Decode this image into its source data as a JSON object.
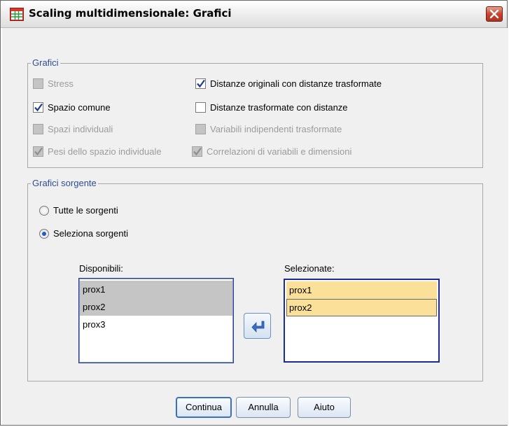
{
  "window": {
    "title": "Scaling multidimensionale: Grafici"
  },
  "grafici": {
    "legend": "Grafici",
    "options": [
      {
        "label": "Stress",
        "checked": false,
        "enabled": false
      },
      {
        "label": "Distanze originali con distanze trasformate",
        "checked": true,
        "enabled": true
      },
      {
        "label": "Spazio comune",
        "checked": true,
        "enabled": true
      },
      {
        "label": "Distanze trasformate con distanze",
        "checked": false,
        "enabled": true
      },
      {
        "label": "Spazi individuali",
        "checked": false,
        "enabled": false
      },
      {
        "label": "Variabili indipendenti trasformate",
        "checked": false,
        "enabled": false
      },
      {
        "label": "Pesi dello spazio individuale",
        "checked": true,
        "enabled": false
      },
      {
        "label": "Correlazioni di variabili e dimensioni",
        "checked": true,
        "enabled": false
      }
    ]
  },
  "sorgente": {
    "legend": "Grafici sorgente",
    "radio_all": "Tutte le sorgenti",
    "radio_select": "Seleziona sorgenti",
    "selected_radio": "select",
    "available_label": "Disponibili:",
    "available_items": [
      "prox1",
      "prox2",
      "prox3"
    ],
    "selected_label": "Selezionate:",
    "selected_items": [
      "prox1",
      "prox2"
    ]
  },
  "buttons": {
    "continue": "Continua",
    "cancel": "Annulla",
    "help": "Aiuto"
  },
  "colors": {
    "legend_text": "#2f4d92",
    "list_selection_gray": "#c5c5c5",
    "list_selection_yellow": "#fbe09a",
    "close_button": "#c9452f"
  },
  "icons": [
    "app-icon",
    "close-icon",
    "check-icon",
    "move-left-arrow-icon"
  ]
}
